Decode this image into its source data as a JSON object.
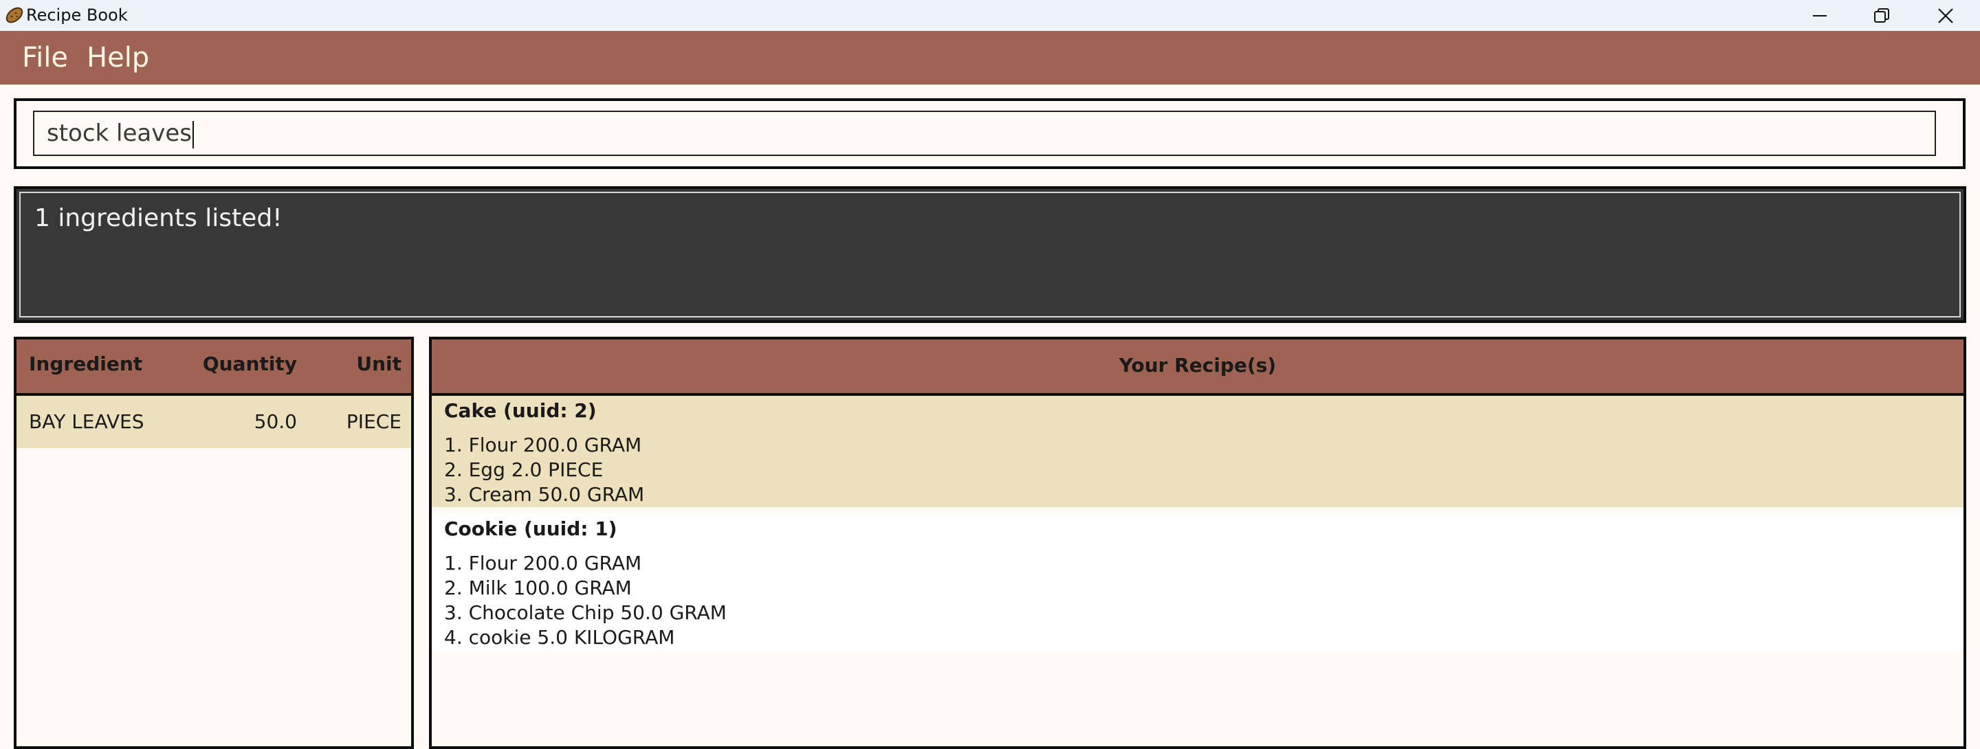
{
  "window": {
    "title": "Recipe Book",
    "icon": "potato-icon",
    "controls": [
      "minimize-icon",
      "restore-icon",
      "close-icon"
    ]
  },
  "menu": {
    "items": [
      {
        "label": "File"
      },
      {
        "label": "Help"
      }
    ]
  },
  "command": {
    "value": "stock leaves"
  },
  "result": {
    "message": "1 ingredients listed!"
  },
  "ingredients": {
    "headers": {
      "ingredient": "Ingredient",
      "quantity": "Quantity",
      "unit": "Unit"
    },
    "rows": [
      {
        "name": "BAY LEAVES",
        "quantity": "50.0",
        "unit": "PIECE"
      }
    ]
  },
  "recipes": {
    "title": "Your Recipe(s)",
    "items": [
      {
        "name": "Cake (uuid: 2)",
        "lines": [
          "1. Flour 200.0 GRAM",
          "2. Egg 2.0 PIECE",
          "3. Cream 50.0 GRAM"
        ]
      },
      {
        "name": "Cookie (uuid: 1)",
        "lines": [
          "1. Flour 200.0 GRAM",
          "2. Milk 100.0 GRAM",
          "3. Chocolate Chip 50.0 GRAM",
          "4. cookie 5.0 KILOGRAM"
        ]
      }
    ]
  },
  "colors": {
    "accent": "#9e6352",
    "background": "#fffaf3",
    "result_bg": "#383838",
    "selected_row": "#ede0bc"
  }
}
